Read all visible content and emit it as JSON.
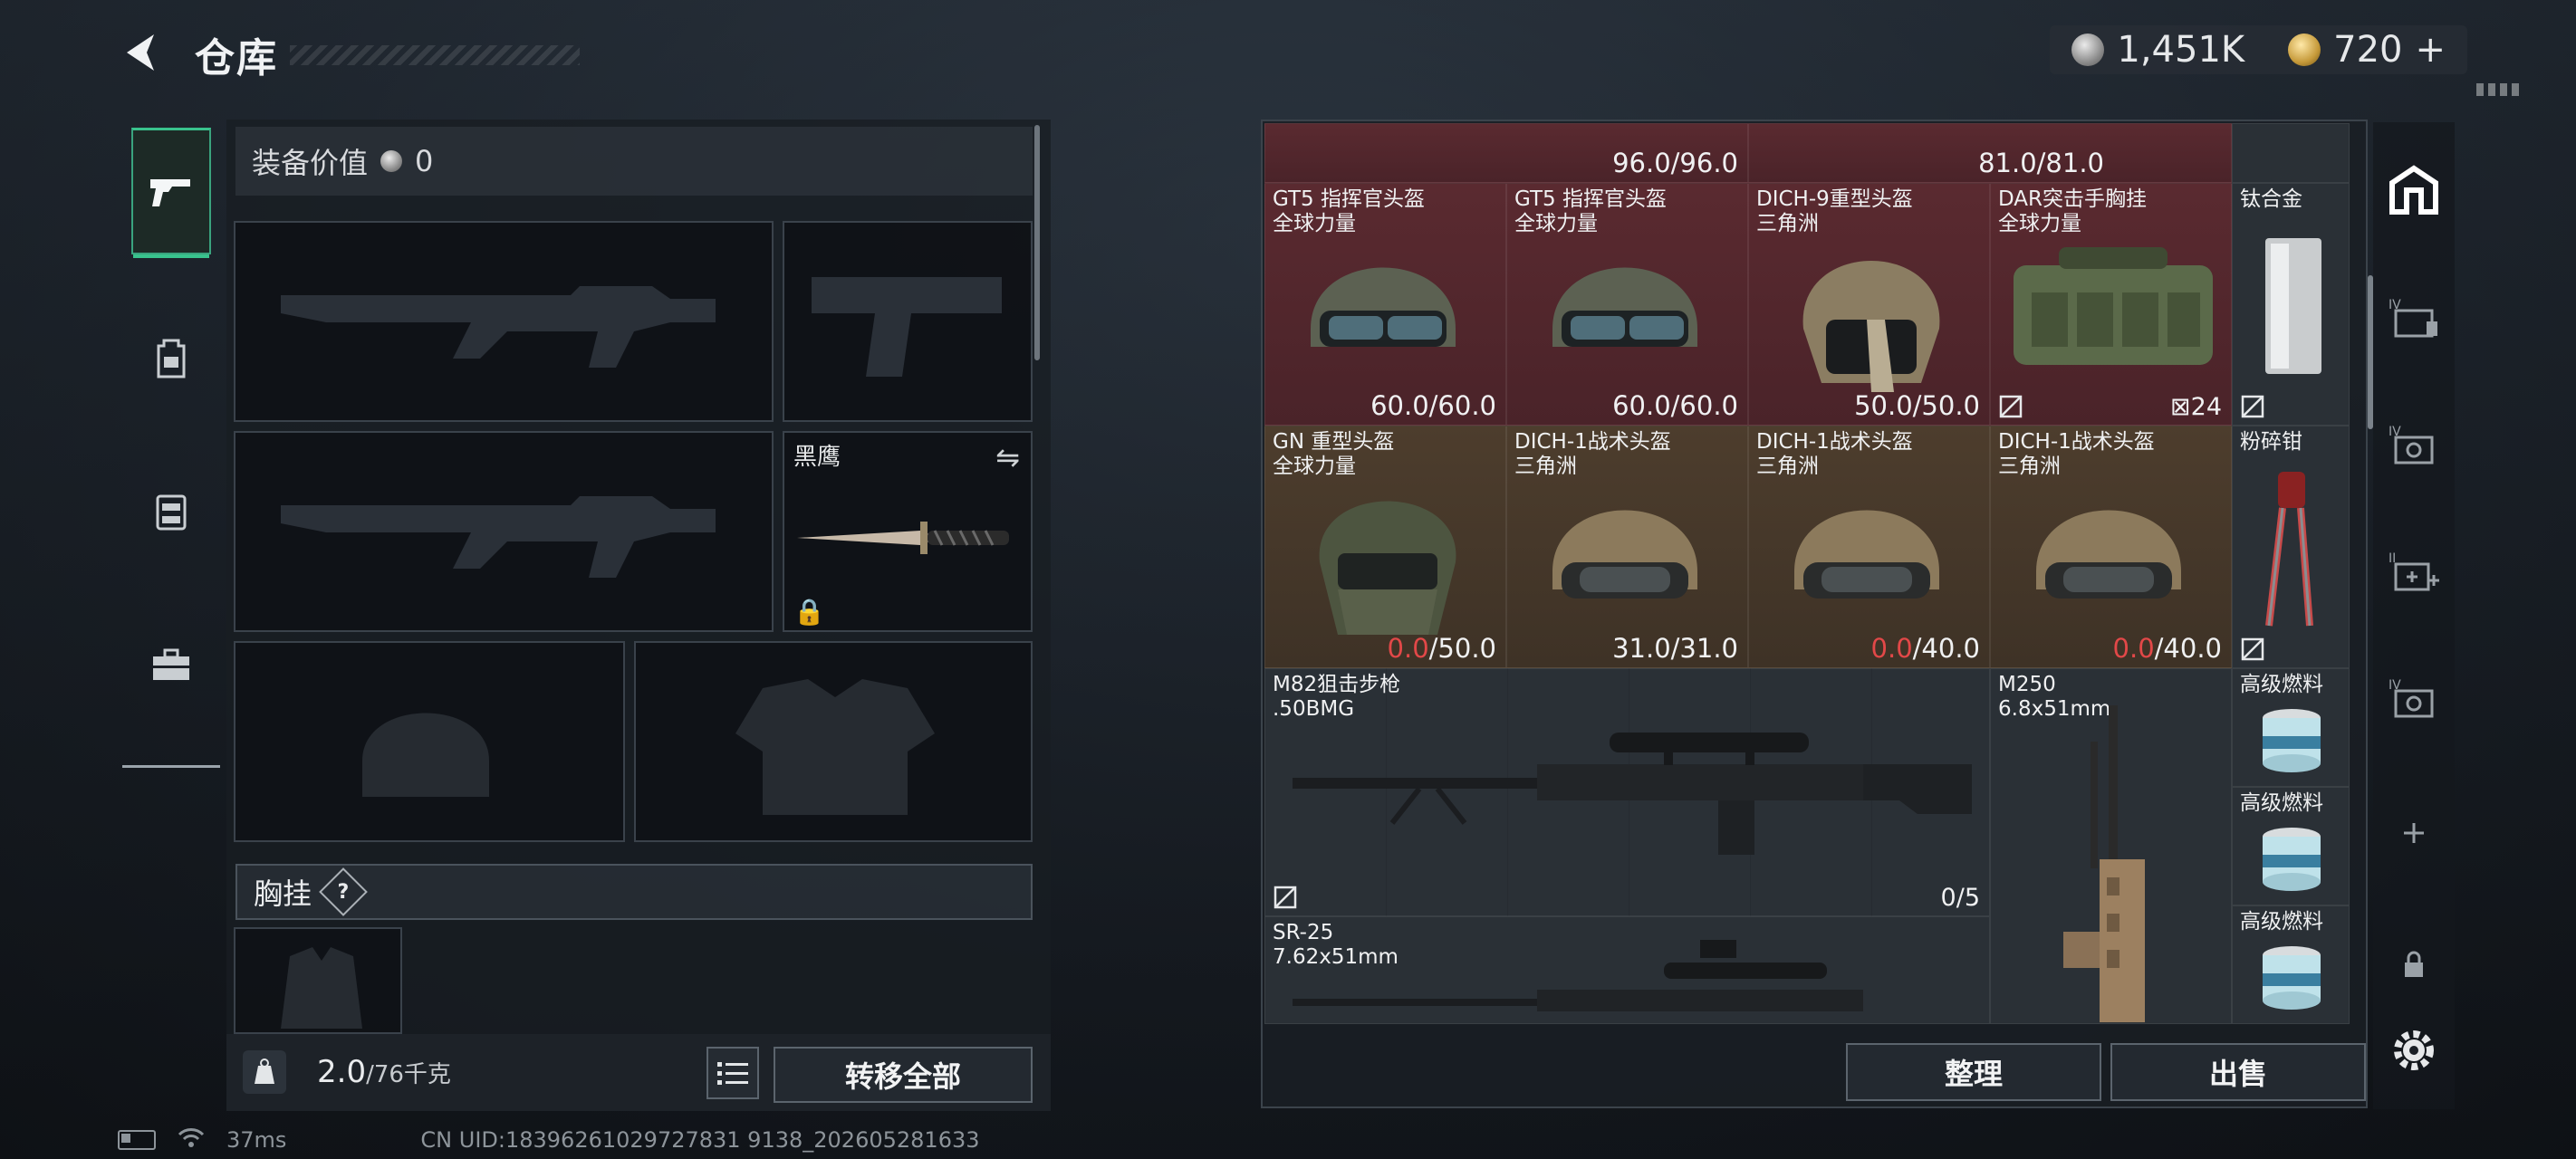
{
  "header": {
    "title": "仓库",
    "silver_amount": "1,451K",
    "gold_amount": "720",
    "gold_plus": "+"
  },
  "left_nav": {
    "items": [
      "pistol-icon",
      "backpack-icon",
      "vest-icon",
      "toolbox-icon"
    ],
    "active": 0
  },
  "loadout": {
    "equipment_value_label": "装备价值",
    "equipment_value": "0",
    "knife_label": "黑鹰",
    "chest_rig_label": "胸挂",
    "chest_rig_help": "?",
    "weight_current": "2.0",
    "weight_max": "/76千克",
    "transfer_all": "转移全部"
  },
  "inventory": {
    "top_durability": [
      "96.0/96.0",
      "81.0/81.0"
    ],
    "items": [
      {
        "name": "GT5 指挥官头盔",
        "sub": "全球力量",
        "dur": "60.0",
        "max": "/60.0",
        "bg": "red"
      },
      {
        "name": "GT5 指挥官头盔",
        "sub": "全球力量",
        "dur": "60.0",
        "max": "/60.0",
        "bg": "red"
      },
      {
        "name": "DICH-9重型头盔",
        "sub": "三角洲",
        "dur": "50.0",
        "max": "/50.0",
        "bg": "red"
      },
      {
        "name": "DAR突击手胸挂",
        "sub": "全球力量",
        "count": "24",
        "bg": "red"
      },
      {
        "name": "钛合金",
        "bg": "gray"
      },
      {
        "name": "GN 重型头盔",
        "sub": "全球力量",
        "dur": "0.0",
        "max": "/50.0",
        "bg": "brown"
      },
      {
        "name": "DICH-1战术头盔",
        "sub": "三角洲",
        "dur": "31.0",
        "max": "/31.0",
        "bg": "brown"
      },
      {
        "name": "DICH-1战术头盔",
        "sub": "三角洲",
        "dur": "0.0",
        "max": "/40.0",
        "bg": "brown"
      },
      {
        "name": "DICH-1战术头盔",
        "sub": "三角洲",
        "dur": "0.0",
        "max": "/40.0",
        "bg": "brown"
      },
      {
        "name": "粉碎钳",
        "bg": "gray"
      },
      {
        "name": "M82狙击步枪",
        "sub": ".50BMG",
        "ammo": "0/5",
        "bg": "gray"
      },
      {
        "name": "M250",
        "sub": "6.8x51mm",
        "bg": "gray"
      },
      {
        "name": "高级燃料",
        "bg": "gray"
      },
      {
        "name": "高级燃料",
        "bg": "gray"
      },
      {
        "name": "高级燃料",
        "bg": "gray"
      },
      {
        "name": "SR-25",
        "sub": "7.62x51mm",
        "bg": "gray"
      }
    ],
    "sort_button": "整理",
    "sell_button": "出售"
  },
  "side_nav": {
    "items": [
      "storage-home-icon",
      "container-iv-icon",
      "container-iv2-icon",
      "container-ii-icon",
      "container-iv3-icon",
      "add-icon",
      "lock-icon"
    ]
  },
  "footer": {
    "ping": "37ms",
    "uid": "CN UID:18396261029727831 9138_202605281633"
  },
  "colors": {
    "accent_green": "#39c38d",
    "item_red_bg": "#5a2a30",
    "item_brown_bg": "#4d3d2d",
    "low_durability": "#e24848"
  }
}
